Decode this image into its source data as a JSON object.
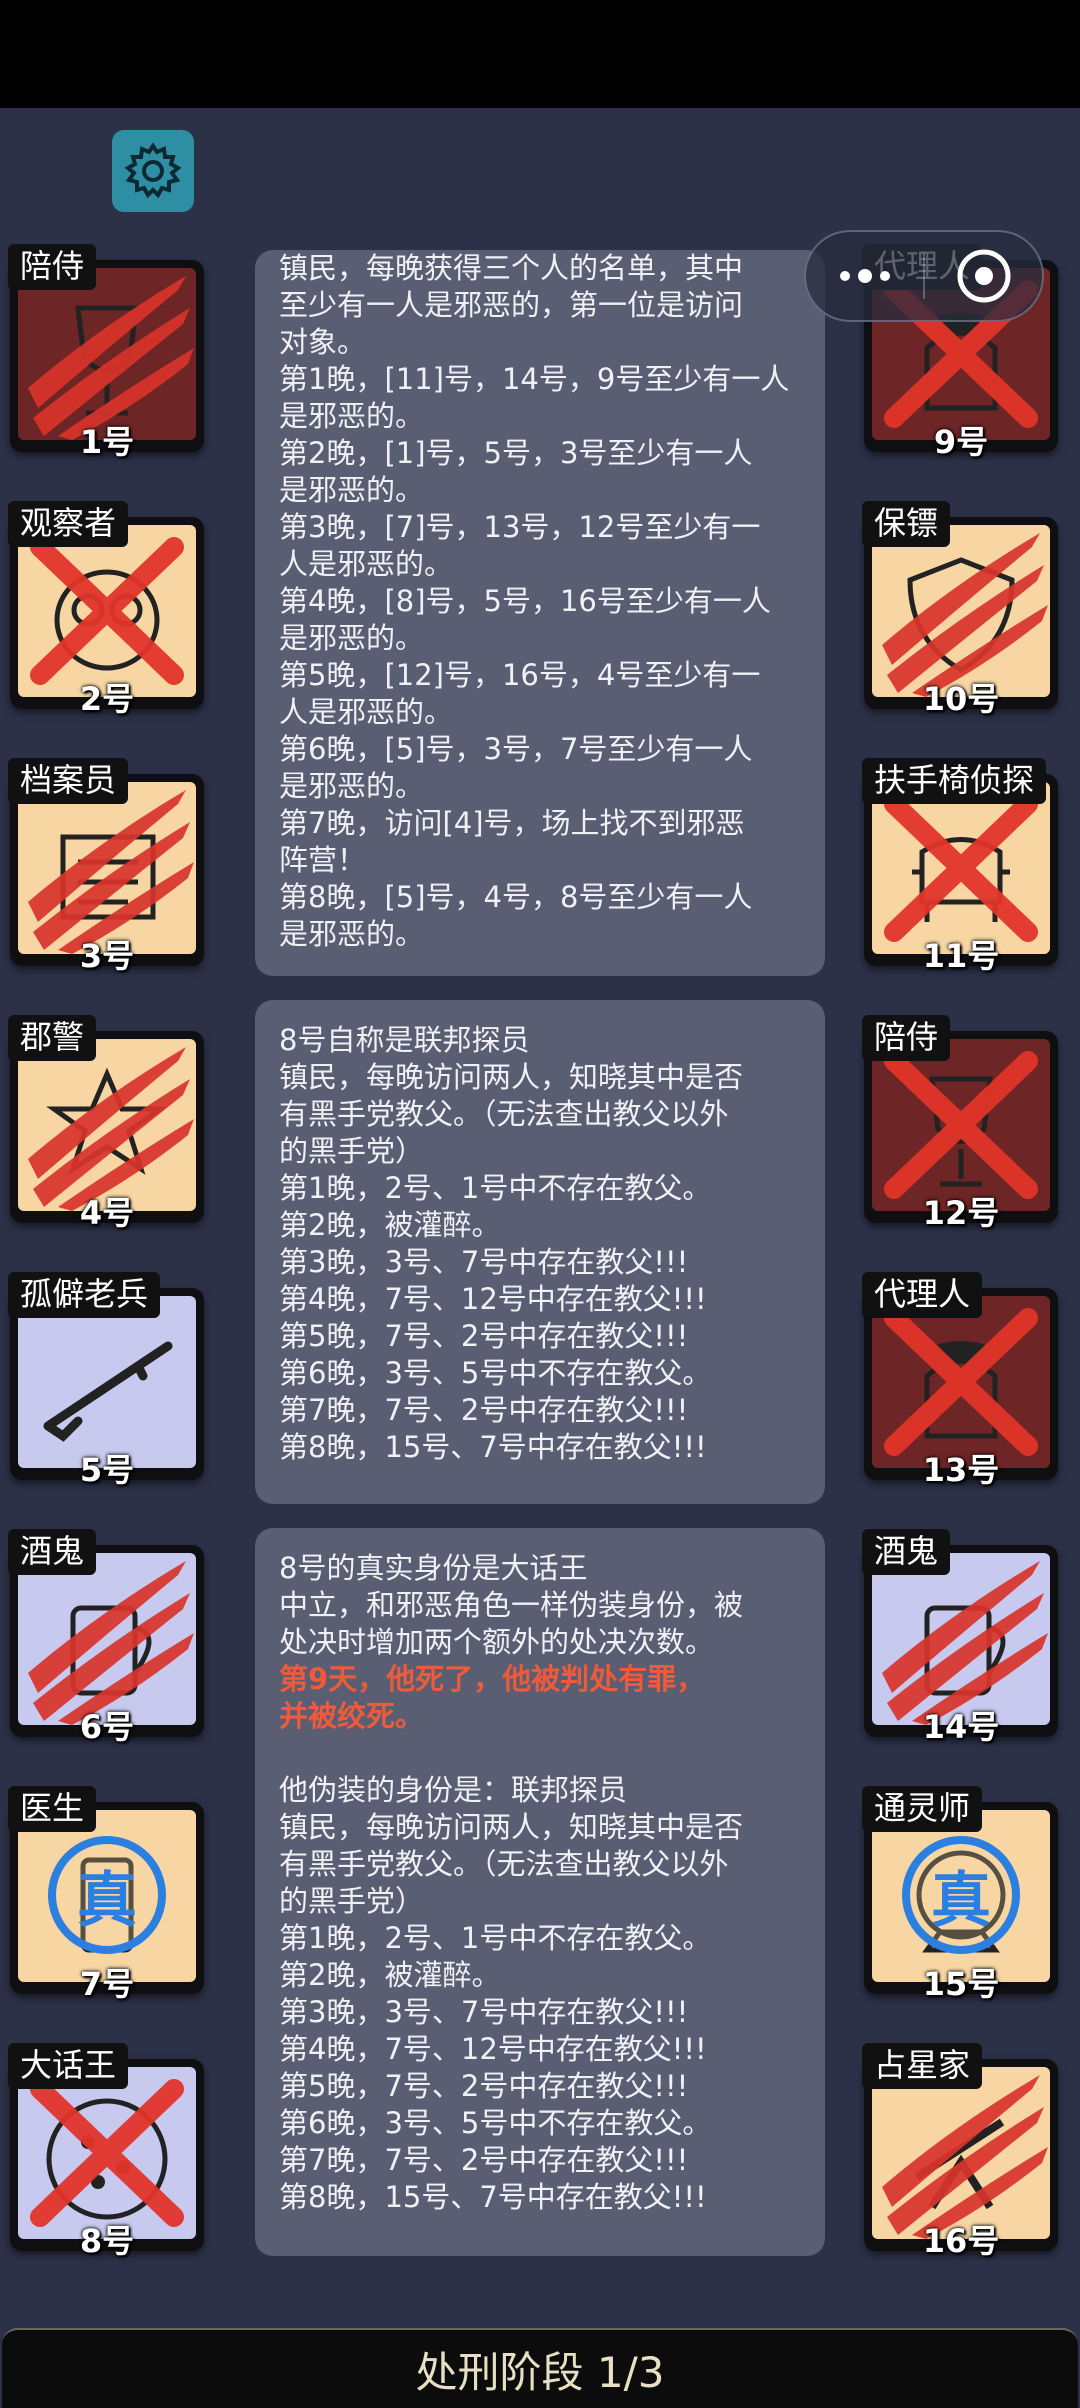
{
  "settings_icon": "gear-icon",
  "capsule": {
    "more_icon": "more-dots-icon",
    "close_icon": "target-circle-icon"
  },
  "left_players": [
    {
      "role": "陪侍",
      "number": "1号",
      "bg": "red",
      "mark": "claw",
      "icon": "wine-glass-icon"
    },
    {
      "role": "观察者",
      "number": "2号",
      "bg": "cream",
      "mark": "cross",
      "icon": "owl-icon"
    },
    {
      "role": "档案员",
      "number": "3号",
      "bg": "cream",
      "mark": "claw",
      "icon": "archive-box-icon"
    },
    {
      "role": "郡警",
      "number": "4号",
      "bg": "cream",
      "mark": "claw",
      "icon": "sheriff-badge-icon"
    },
    {
      "role": "孤僻老兵",
      "number": "5号",
      "bg": "lav",
      "mark": "none",
      "icon": "rifle-icon"
    },
    {
      "role": "酒鬼",
      "number": "6号",
      "bg": "lav",
      "mark": "claw",
      "icon": "beer-mug-icon"
    },
    {
      "role": "医生",
      "number": "7号",
      "bg": "cream",
      "mark": "stamp",
      "icon": "medicine-bottle-icon"
    },
    {
      "role": "大话王",
      "number": "8号",
      "bg": "lav",
      "mark": "cross",
      "icon": "pizza-icon"
    }
  ],
  "right_players": [
    {
      "role": "代理人",
      "number": "9号",
      "bg": "red",
      "mark": "cross",
      "icon": "agent-coat-icon"
    },
    {
      "role": "保镖",
      "number": "10号",
      "bg": "cream",
      "mark": "claw",
      "icon": "shield-icon"
    },
    {
      "role": "扶手椅侦探",
      "number": "11号",
      "bg": "cream",
      "mark": "cross",
      "icon": "armchair-icon"
    },
    {
      "role": "陪侍",
      "number": "12号",
      "bg": "red",
      "mark": "cross",
      "icon": "wine-glass-icon"
    },
    {
      "role": "代理人",
      "number": "13号",
      "bg": "red",
      "mark": "cross",
      "icon": "agent-coat-icon"
    },
    {
      "role": "酒鬼",
      "number": "14号",
      "bg": "lav",
      "mark": "claw",
      "icon": "beer-mug-icon"
    },
    {
      "role": "通灵师",
      "number": "15号",
      "bg": "cream",
      "mark": "stamp",
      "icon": "crystal-ball-icon"
    },
    {
      "role": "占星家",
      "number": "16号",
      "bg": "cream",
      "mark": "claw",
      "icon": "telescope-icon"
    }
  ],
  "stamp_text": "真",
  "log_panels": [
    {
      "lines": [
        "镇民，每晚获得三个人的名单，其中",
        "至少有一人是邪恶的，第一位是访问",
        "对象。",
        "第1晚，[11]号，14号，9号至少有一人",
        "是邪恶的。",
        "第2晚，[1]号，5号，3号至少有一人",
        "是邪恶的。",
        "第3晚，[7]号，13号，12号至少有一",
        "人是邪恶的。",
        "第4晚，[8]号，5号，16号至少有一人",
        "是邪恶的。",
        "第5晚，[12]号，16号，4号至少有一",
        "人是邪恶的。",
        "第6晚，[5]号，3号，7号至少有一人",
        "是邪恶的。",
        "第7晚，访问[4]号，场上找不到邪恶",
        "阵营！",
        "第8晚，[5]号，4号，8号至少有一人",
        "是邪恶的。"
      ]
    },
    {
      "lines": [
        "8号自称是联邦探员",
        "镇民，每晚访问两人，知晓其中是否",
        "有黑手党教父。（无法查出教父以外",
        "的黑手党）",
        "第1晚，2号、1号中不存在教父。",
        "第2晚，被灌醉。",
        "第3晚，3号、7号中存在教父!!!",
        "第4晚，7号、12号中存在教父!!!",
        "第5晚，7号、2号中存在教父!!!",
        "第6晚，3号、5号中不存在教父。",
        "第7晚，7号、2号中存在教父!!!",
        "第8晚，15号、7号中存在教父!!!"
      ]
    },
    {
      "lines_a": [
        "8号的真实身份是大话王",
        "中立，和邪恶角色一样伪装身份，被",
        "处决时增加两个额外的处决次数。"
      ],
      "red_lines": [
        "第9天，他死了，他被判处有罪，",
        "并被绞死。"
      ],
      "lines_b": [
        "",
        "他伪装的身份是：联邦探员",
        "镇民，每晚访问两人，知晓其中是否",
        "有黑手党教父。（无法查出教父以外",
        "的黑手党）",
        "第1晚，2号、1号中不存在教父。",
        "第2晚，被灌醉。",
        "第3晚，3号、7号中存在教父!!!",
        "第4晚，7号、12号中存在教父!!!",
        "第5晚，7号、2号中存在教父!!!",
        "第6晚，3号、5号中不存在教父。",
        "第7晚，7号、2号中存在教父!!!",
        "第8晚，15号、7号中存在教父!!!"
      ]
    }
  ],
  "colors": {
    "background": "#2c3148",
    "panel": "#5a5e73",
    "accent_red": "#ef5a3a",
    "stamp_blue": "#2a7fe0",
    "gear_bg": "#2e8ea3"
  },
  "footer": {
    "phase_label": "处刑阶段 1/3"
  }
}
